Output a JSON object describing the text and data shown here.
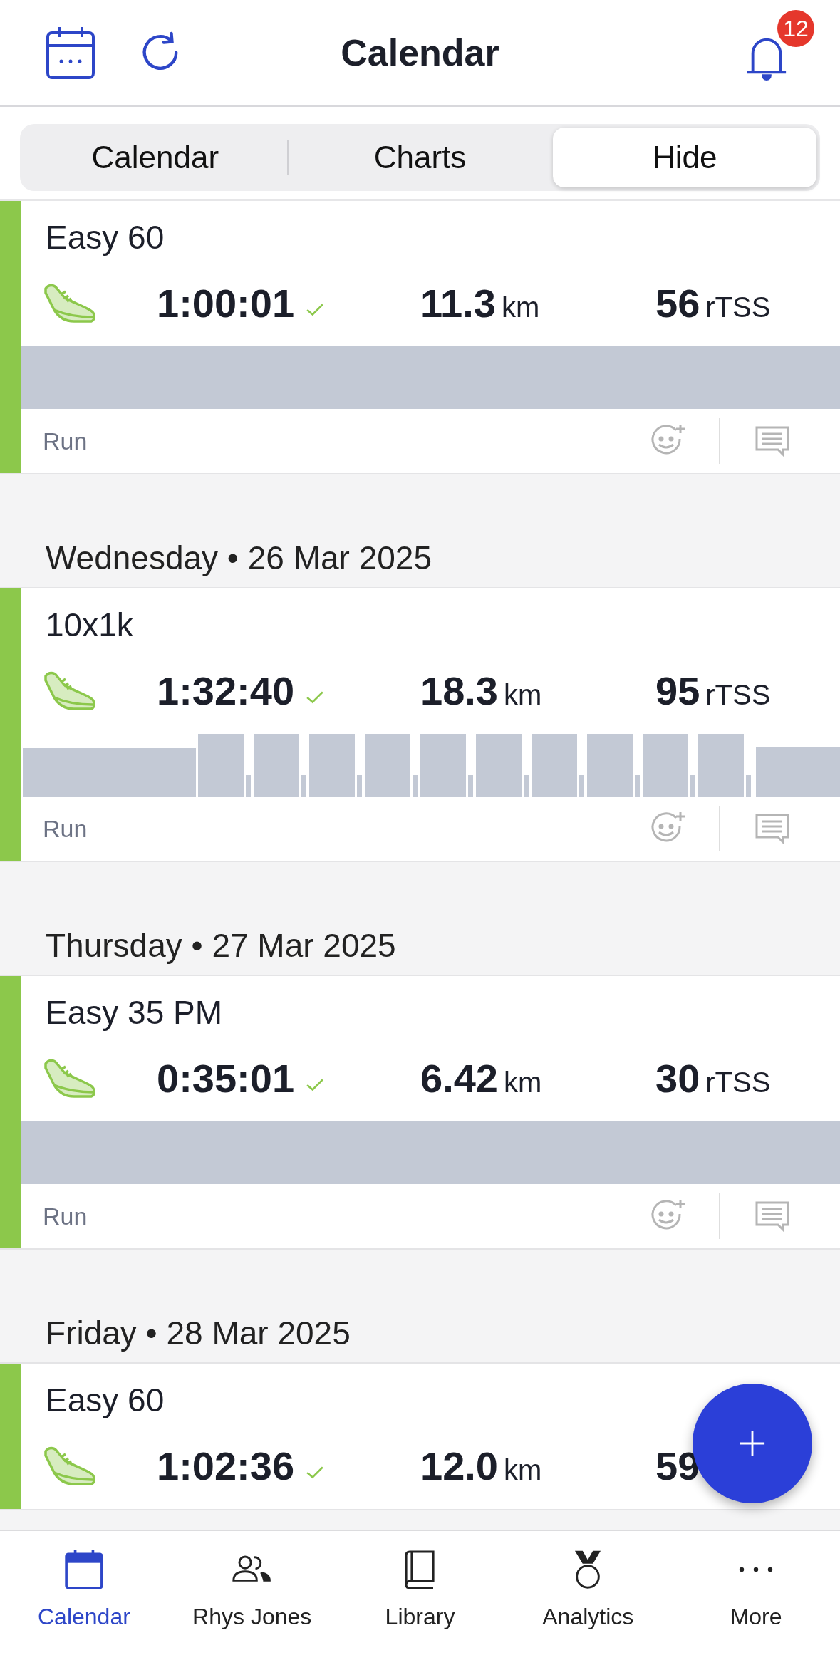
{
  "header": {
    "title": "Calendar",
    "notification_count": "12"
  },
  "segments": [
    {
      "label": "Calendar",
      "selected": false
    },
    {
      "label": "Charts",
      "selected": false
    },
    {
      "label": "Hide",
      "selected": true
    }
  ],
  "days": [
    {
      "workouts": [
        {
          "title": "Easy 60",
          "completed": true,
          "duration": "1:00:01",
          "distance": "11.3",
          "distance_unit": "km",
          "load": "56",
          "load_unit": "rTSS",
          "structure": {
            "kind": "steady"
          },
          "sport": "Run"
        }
      ]
    },
    {
      "date": "Wednesday • 26 Mar 2025",
      "workouts": [
        {
          "title": "10x1k",
          "completed": true,
          "duration": "1:32:40",
          "distance": "18.3",
          "distance_unit": "km",
          "load": "95",
          "load_unit": "rTSS",
          "structure": {
            "kind": "intervals"
          },
          "sport": "Run"
        }
      ]
    },
    {
      "date": "Thursday • 27 Mar 2025",
      "workouts": [
        {
          "title": "Easy 35 PM",
          "completed": true,
          "duration": "0:35:01",
          "distance": "6.42",
          "distance_unit": "km",
          "load": "30",
          "load_unit": "rTSS",
          "structure": {
            "kind": "steady"
          },
          "sport": "Run"
        }
      ]
    },
    {
      "date": "Friday • 28 Mar 2025",
      "workouts": [
        {
          "title": "Easy 60",
          "completed": true,
          "duration": "1:02:36",
          "distance": "12.0",
          "distance_unit": "km",
          "load": "59"
        }
      ]
    }
  ],
  "nav": [
    {
      "label": "Calendar",
      "kind": "calendar",
      "selected": true
    },
    {
      "label": "Rhys Jones",
      "kind": "people",
      "selected": false
    },
    {
      "label": "Library",
      "kind": "book",
      "selected": false
    },
    {
      "label": "Analytics",
      "kind": "medal",
      "selected": false
    },
    {
      "label": "More",
      "kind": "dots",
      "selected": false
    }
  ]
}
